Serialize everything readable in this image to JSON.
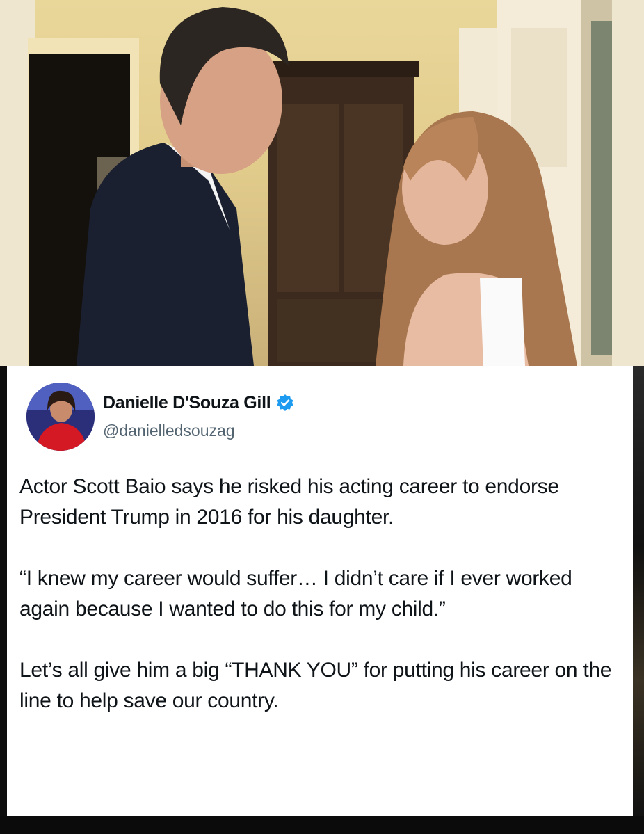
{
  "photo": {
    "icon": "photo-of-two-people"
  },
  "post": {
    "author_name": "Danielle D'Souza Gill",
    "handle": "@danielledsouzag",
    "verified_icon": "verified-badge-icon",
    "verified_color": "#1d9bf0",
    "paragraph_1": "Actor Scott Baio says he risked his acting career to endorse President Trump in 2016 for his daughter.",
    "paragraph_2": "“I knew my career would suffer… I didn’t care if I ever worked again because I wanted to do this for my child.”",
    "paragraph_3": "Let’s all give him a big “THANK YOU” for putting his career on the line to help save our country."
  }
}
